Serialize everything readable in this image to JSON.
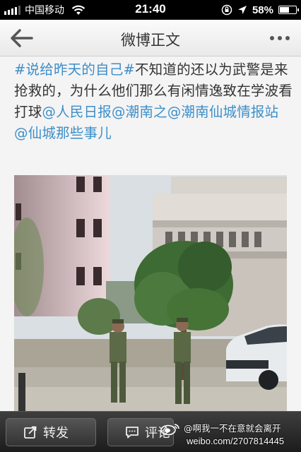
{
  "status_bar": {
    "carrier": "中国移动",
    "time": "21:40",
    "battery_text": "58%",
    "battery_level": 0.58,
    "signal_bars": 4
  },
  "navbar": {
    "title": "微博正文",
    "back_icon": "arrow-left-icon",
    "more_icon": "more-dots-icon"
  },
  "post": {
    "topic": "#说给昨天的自己#",
    "text": "不知道的还以为武警是来抢救的，为什么他们那么有闲情逸致在学波看打球",
    "mentions": [
      "@人民日报",
      "@潮南之",
      "@潮南仙城情报站",
      "@仙城那些事儿"
    ]
  },
  "bottom_bar": {
    "repost_label": "转发",
    "comment_label": "评论"
  },
  "watermark": {
    "user": "@啊我一不在意就会离开",
    "url": "weibo.com/2707814445"
  },
  "colors": {
    "link": "#3c8ec9",
    "text": "#333333",
    "bar_dark": "#2a2a2a"
  }
}
